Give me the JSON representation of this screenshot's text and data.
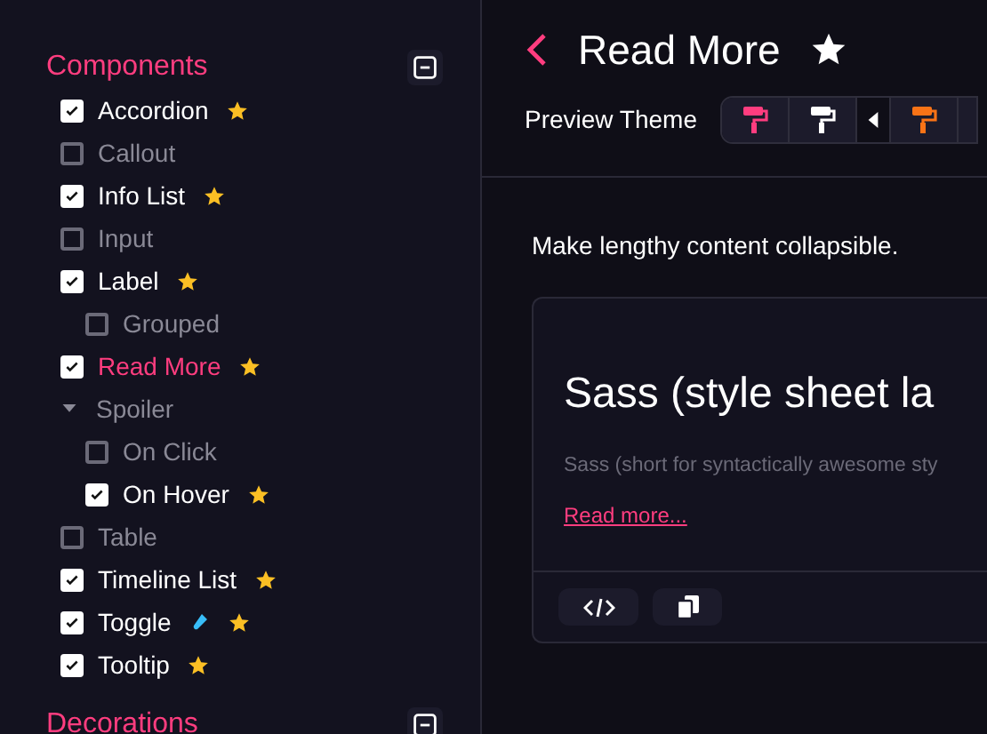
{
  "sidebar": {
    "sections": [
      {
        "title": "Components",
        "expanded": true,
        "items": [
          {
            "kind": "checkbox",
            "label": "Accordion",
            "checked": true,
            "starred": true,
            "selected": false
          },
          {
            "kind": "checkbox",
            "label": "Callout",
            "checked": false,
            "starred": false,
            "selected": false
          },
          {
            "kind": "checkbox",
            "label": "Info List",
            "checked": true,
            "starred": true,
            "selected": false
          },
          {
            "kind": "checkbox",
            "label": "Input",
            "checked": false,
            "starred": false,
            "selected": false
          },
          {
            "kind": "checkbox",
            "label": "Label",
            "checked": true,
            "starred": true,
            "selected": false,
            "children": [
              {
                "kind": "checkbox",
                "label": "Grouped",
                "checked": false,
                "starred": false,
                "selected": false
              }
            ]
          },
          {
            "kind": "checkbox",
            "label": "Read More",
            "checked": true,
            "starred": true,
            "selected": true
          },
          {
            "kind": "group",
            "label": "Spoiler",
            "expanded": true,
            "children": [
              {
                "kind": "checkbox",
                "label": "On Click",
                "checked": false,
                "starred": false,
                "selected": false
              },
              {
                "kind": "checkbox",
                "label": "On Hover",
                "checked": true,
                "starred": true,
                "selected": false
              }
            ]
          },
          {
            "kind": "checkbox",
            "label": "Table",
            "checked": false,
            "starred": false,
            "selected": false
          },
          {
            "kind": "checkbox",
            "label": "Timeline List",
            "checked": true,
            "starred": true,
            "selected": false
          },
          {
            "kind": "checkbox",
            "label": "Toggle",
            "checked": true,
            "starred": true,
            "experimental": true,
            "selected": false
          },
          {
            "kind": "checkbox",
            "label": "Tooltip",
            "checked": true,
            "starred": true,
            "selected": false
          }
        ]
      },
      {
        "title": "Decorations",
        "expanded": true
      }
    ]
  },
  "page": {
    "title": "Read More",
    "starred": true,
    "preview_theme": {
      "label": "Preview Theme",
      "themes": [
        {
          "color": "#ff3d7f"
        },
        {
          "color": "#ffffff"
        },
        {
          "kind": "arrow"
        },
        {
          "color": "#f97316"
        }
      ]
    },
    "description": "Make lengthy content collapsible.",
    "demo": {
      "heading": "Sass (style sheet la",
      "text": "Sass (short for syntactically awesome sty",
      "link": "Read more..."
    }
  }
}
